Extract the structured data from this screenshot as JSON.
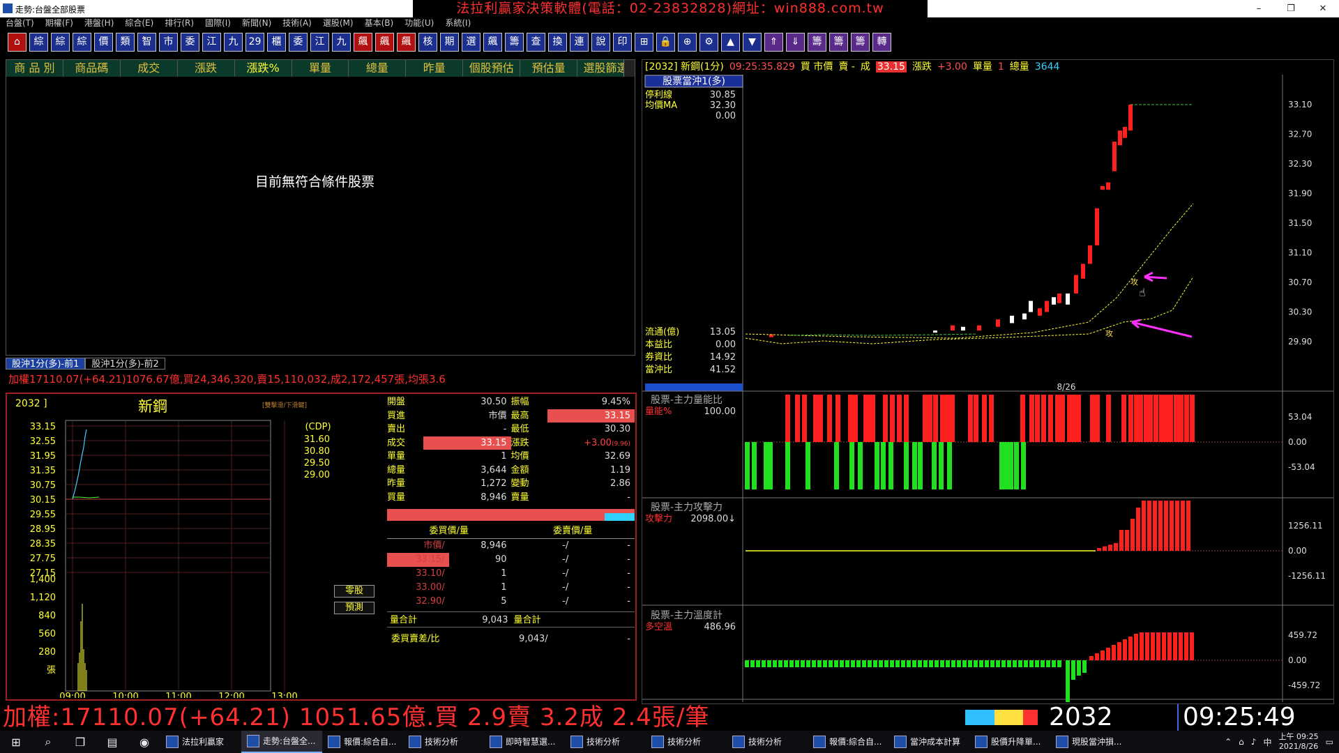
{
  "window": {
    "title": "走勢:台盤全部股票",
    "banner": "法拉利贏家決策軟體(電話：02-23832828)網址：win888.com.tw",
    "controls": [
      "–",
      "❐",
      "✕"
    ]
  },
  "menu": [
    "台盤(T)",
    "期權(F)",
    "港盤(H)",
    "綜合(E)",
    "排行(R)",
    "國際(I)",
    "新聞(N)",
    "技術(A)",
    "選股(M)",
    "基本(B)",
    "功能(U)",
    "系統(I)"
  ],
  "toolbar": [
    "⌂",
    "綜",
    "綜",
    "綜",
    "價",
    "類",
    "智",
    "市",
    "委",
    "江",
    "九",
    "29",
    "櫃",
    "委",
    "江",
    "九",
    "飆",
    "飆",
    "飆",
    "核",
    "期",
    "選",
    "飆",
    "籌",
    "查",
    "換",
    "連",
    "說",
    "印",
    "⊞",
    "🔒",
    "⊕",
    "⚙",
    "▲",
    "▼",
    "⇑",
    "⇓",
    "籌",
    "籌",
    "籌",
    "轉"
  ],
  "selector": {
    "tabs": [
      "商 品 別",
      "商品碼",
      "成交",
      "漲跌",
      "漲跌%",
      "單量",
      "總量",
      "昨量",
      "個股預估",
      "預估量",
      "選股篩選"
    ],
    "active_tab": "漲跌%",
    "empty_message": "目前無符合條件股票",
    "bottom_tabs": [
      "股沖1分(多)-前1",
      "股沖1分(多)-前2"
    ],
    "index_line": "加權17110.07(+64.21)1076.67億,買24,346,320,賣15,110,032,成2,172,457張,均張3.6"
  },
  "quote": {
    "code": "2032 ]",
    "name": "新鋼",
    "note": "[雙擊滑/下滑鍵]",
    "cdp_label": "(CDP)",
    "price_ticks": [
      "33.15",
      "32.55",
      "31.95",
      "31.35",
      "30.75",
      "30.15",
      "29.55",
      "28.95",
      "28.35",
      "27.75",
      "27.15"
    ],
    "vol_ticks": [
      "1,400",
      "1,120",
      "840",
      "560",
      "280",
      "張"
    ],
    "cdp": [
      "31.60",
      "30.80",
      "29.50",
      "29.00"
    ],
    "time_ticks": [
      "09:00",
      "10:00",
      "11:00",
      "12:00",
      "13:00"
    ],
    "btn_odd": "零股",
    "btn_predict": "預測",
    "fields": [
      {
        "l1": "開盤",
        "v1": "30.50",
        "l2": "振幅",
        "v2": "9.45%"
      },
      {
        "l1": "買進",
        "v1": "市價",
        "l2": "最高",
        "v2": "33.15"
      },
      {
        "l1": "賣出",
        "v1": "-",
        "l2": "最低",
        "v2": "30.30"
      },
      {
        "l1": "成交",
        "v1": "33.15",
        "l2": "漲跌",
        "v2": "+3.00"
      },
      {
        "l1": "單量",
        "v1": "1",
        "l2": "均價",
        "v2": "32.69"
      },
      {
        "l1": "總量",
        "v1": "3,644",
        "l2": "金額",
        "v2": "1.19"
      },
      {
        "l1": "昨量",
        "v1": "1,272",
        "l2": "變動",
        "v2": "2.86"
      },
      {
        "l1": "買量",
        "v1": "8,946",
        "l2": "賣量",
        "v2": "-"
      }
    ],
    "change_pct": "(9.96)"
  },
  "orderbook": {
    "headers": [
      "委買價/量",
      "委賣價/量"
    ],
    "rows": [
      {
        "bid": "市價/",
        "bqty": "8,946",
        "ask": "-/",
        "aqty": "-"
      },
      {
        "bid": "33.15/",
        "bqty": "90",
        "ask": "-/",
        "aqty": "-"
      },
      {
        "bid": "33.10/",
        "bqty": "1",
        "ask": "-/",
        "aqty": "-"
      },
      {
        "bid": "33.00/",
        "bqty": "1",
        "ask": "-/",
        "aqty": "-"
      },
      {
        "bid": "32.90/",
        "bqty": "5",
        "ask": "-/",
        "aqty": "-"
      }
    ],
    "sum_label": "量合計",
    "bid_total": "9,043",
    "ask_total": "",
    "diff_label": "委買賣差/比",
    "diff_value": "9,043/",
    "diff_ratio": "-",
    "bid_ratio": 0.88
  },
  "chart": {
    "header": {
      "code": "[2032] 新鋼(1分)",
      "time": "09:25:35.829",
      "buy": "買 市價",
      "sell": "賣 -",
      "deal_label": "成",
      "deal": "33.15",
      "chg_label": "漲跌",
      "chg": "+3.00",
      "vol_label": "單量",
      "vol": "1",
      "total_label": "總量",
      "total": "3644"
    },
    "title_box": "股票當沖1(多)",
    "left_top": [
      {
        "k": "停利線",
        "v": "30.85"
      },
      {
        "k": "均價MA",
        "v": "32.30"
      },
      {
        "k": "",
        "v": "0.00"
      }
    ],
    "left_bottom": [
      {
        "k": "流通(億)",
        "v": "13.05"
      },
      {
        "k": "本益比",
        "v": "0.00"
      },
      {
        "k": "券資比",
        "v": "14.92"
      },
      {
        "k": "當沖比",
        "v": "41.52"
      }
    ],
    "price_ticks": [
      "33.10",
      "32.70",
      "32.30",
      "31.90",
      "31.50",
      "31.10",
      "30.70",
      "30.30",
      "29.90"
    ],
    "date_label": "8/26",
    "marker": "攻",
    "panels": [
      {
        "title": "股票-主力量能比",
        "key": "量能%",
        "value": "100.00",
        "ticks": [
          "53.04",
          "0.00",
          "-53.04"
        ]
      },
      {
        "title": "股票-主力攻擊力",
        "key": "攻擊力",
        "value": "2098.00↓",
        "ticks": [
          "1256.11",
          "0.00",
          "-1256.11"
        ]
      },
      {
        "title": "股票-主力溫度計",
        "key": "多空溫",
        "value": "486.96",
        "ticks": [
          "459.72",
          "0.00",
          "-459.72"
        ]
      }
    ]
  },
  "ticker": {
    "text": "加權:17110.07(+64.21) 1051.65億.買 2.9賣 3.2成 2.4張/筆",
    "code": "2032",
    "time": "09:25:49"
  },
  "taskbar": {
    "tasks": [
      "法拉利贏家",
      "走勢:台盤全...",
      "報價:綜合自...",
      "技術分析",
      "即時智慧選...",
      "技術分析",
      "技術分析",
      "技術分析",
      "報價:綜合自...",
      "當沖成本計算",
      "股價升降單...",
      "現股當沖損..."
    ],
    "active": 1,
    "clock_time": "上午 09:25",
    "clock_date": "2021/8/26"
  }
}
